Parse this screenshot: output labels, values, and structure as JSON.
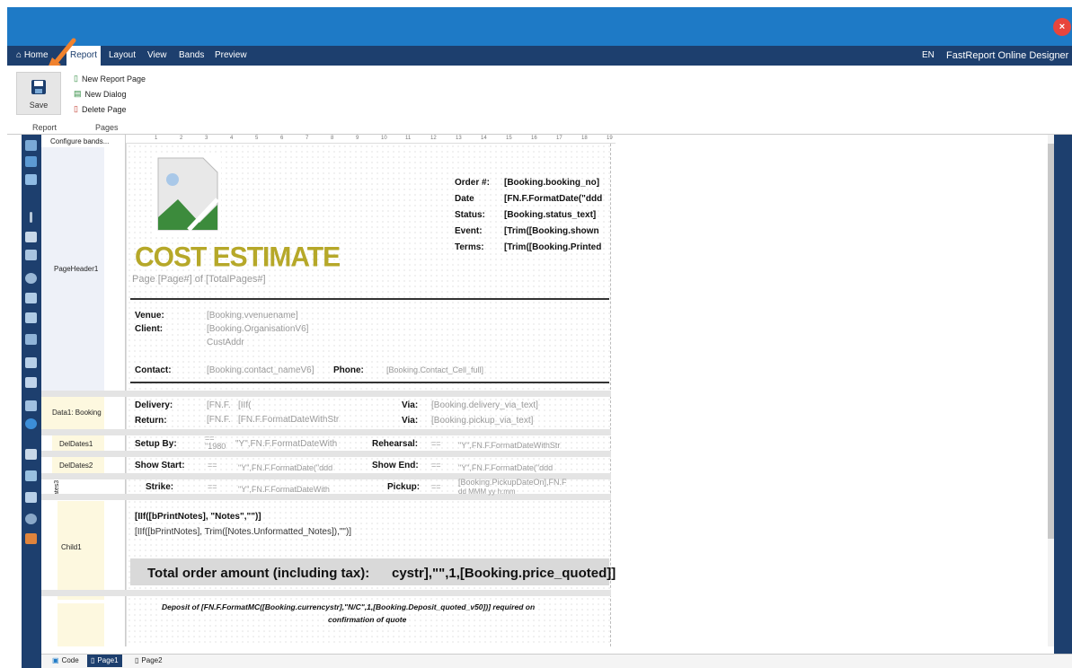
{
  "window": {
    "close_label": "×"
  },
  "menu": {
    "home": "Home",
    "report": "Report",
    "layout": "Layout",
    "view": "View",
    "bands": "Bands",
    "preview": "Preview",
    "lang": "EN",
    "app_title": "FastReport Online Designer"
  },
  "ribbon": {
    "save": "Save",
    "new_report_page": "New Report Page",
    "new_dialog": "New Dialog",
    "delete_page": "Delete Page",
    "group_report": "Report",
    "group_pages": "Pages"
  },
  "bands": {
    "configure": "Configure bands...",
    "page_header": "PageHeader1",
    "data1": "Data1: Booking",
    "deldates1": "DelDates1",
    "deldates2": "DelDates2",
    "dates3": "ates3",
    "child1": "Child1"
  },
  "ruler": [
    "1",
    "2",
    "3",
    "4",
    "5",
    "6",
    "7",
    "8",
    "9",
    "10",
    "11",
    "12",
    "13",
    "14",
    "15",
    "16",
    "17",
    "18",
    "19"
  ],
  "report": {
    "title": "COST ESTIMATE",
    "page_num": "Page [Page#] of [TotalPages#]",
    "order_label": "Order #:",
    "order_val": "[Booking.booking_no]",
    "date_label": "Date",
    "date_val": "[FN.F.FormatDate(\"ddd",
    "status_label": "Status:",
    "status_val": "[Booking.status_text]",
    "event_label": "Event:",
    "event_val": "[Trim([Booking.shown",
    "terms_label": "Terms:",
    "terms_val": "[Trim([Booking.Printed",
    "venue_label": "Venue:",
    "venue_val": "[Booking.vvenuename]",
    "client_label": "Client:",
    "client_val": "[Booking.OrganisationV6]",
    "custaddr": "CustAddr",
    "contact_label": "Contact:",
    "contact_val": "[Booking.contact_nameV6]",
    "phone_label": "Phone:",
    "phone_val": "[Booking.Contact_Cell_full]",
    "delivery_label": "Delivery:",
    "delivery_v1": "[FN.F.",
    "delivery_v2": "[IIf(",
    "via_label": "Via:",
    "via_val": "[Booking.delivery_via_text]",
    "return_label": "Return:",
    "return_v1": "[FN.F.",
    "return_v2": "[FN.F.FormatDateWithStr",
    "via2_label": "Via:",
    "via2_val": "[Booking.pickup_via_text]",
    "setup_label": "Setup By:",
    "setup_v1": "==",
    "setup_v2": "\"1980",
    "setup_v3": "\"Y\",FN.F.FormatDateWith",
    "rehearsal_label": "Rehearsal:",
    "rehearsal_v1": "==",
    "rehearsal_v2": "\"Y\",FN.F.FormatDateWithStr",
    "showstart_label": "Show Start:",
    "showstart_v1": "==",
    "showstart_v2": "\"Y\",FN.F.FormatDate(\"ddd",
    "showend_label": "Show End:",
    "showend_v1": "==",
    "showend_v2": "\"Y\",FN.F.FormatDate(\"ddd",
    "strike_label": "Strike:",
    "strike_v1": "==",
    "strike_v2": "\"Y\",FN.F.FormatDateWith",
    "pickup_label": "Pickup:",
    "pickup_v1": "==",
    "pickup_v2": "[Booking.PickupDateOn],FN.F",
    "pickup_v3": "dd MMM yy h:mm",
    "notes_title": "[IIf([bPrintNotes], \"Notes\",\"\")]",
    "notes_body": "[IIf([bPrintNotes], Trim([Notes.Unformatted_Notes]),\"\")]",
    "total_label": "Total order amount (including tax):",
    "total_val": "cystr],\"\",1,[Booking.price_quoted]]",
    "deposit_line1": "Deposit of [FN.F.FormatMC([Booking.currencystr],\"N/C\",1,[Booking.Deposit_quoted_v50])] required on",
    "deposit_line2": "confirmation of quote"
  },
  "bottom": {
    "code": "Code",
    "page1": "Page1",
    "page2": "Page2"
  },
  "colors": {
    "accent": "#1e7ac6",
    "nav": "#1d3f6e",
    "title": "#b6a829"
  }
}
